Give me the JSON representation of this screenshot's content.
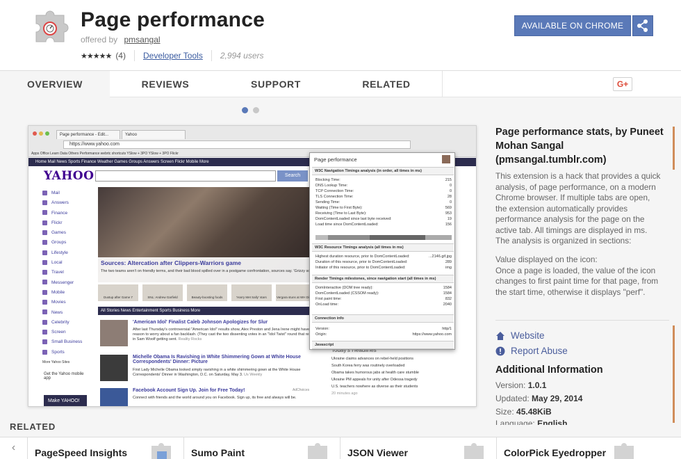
{
  "header": {
    "title": "Page performance",
    "offered_by_label": "offered by",
    "author": "pmsangal",
    "rating_stars": "★★★★★",
    "rating_count": "(4)",
    "category": "Developer Tools",
    "users": "2,994 users",
    "cta_label": "AVAILABLE ON CHROME"
  },
  "tabs": {
    "overview": "OVERVIEW",
    "reviews": "REVIEWS",
    "support": "SUPPORT",
    "related": "RELATED",
    "gplus": "G+"
  },
  "screenshot": {
    "tab1": "Page performance - Edit...",
    "tab2": "Yahoo",
    "url": "https://www.yahoo.com",
    "bookmarks": "Apps  Office  Learn  Data  Others  Performance  webrtc  shortcuts  YSlow + 3PO  YSlow + 3PO  Flickr",
    "nav": "Home  Mail  News  Sports  Finance  Weather  Games  Groups  Answers  Screen  Flickr  Mobile  More",
    "yahoo_logo": "YAHOO!",
    "search_btn": "Search",
    "menu": [
      "Mail",
      "Answers",
      "Finance",
      "Flickr",
      "Games",
      "Groups",
      "Lifestyle",
      "Local",
      "Travel",
      "Messenger",
      "Mobile",
      "Movies",
      "News",
      "Celebrity",
      "Screen",
      "Small Business",
      "Sports"
    ],
    "more_sites": "More Yahoo Sites",
    "hero_title": "Sources: Altercation after Clippers-Warriors game",
    "hero_sub": "The two teams aren't on friendly terms, and their bad blood spilled over in a postgame confrontation, sources say. 'Grizzy scene'",
    "thumbs": [
      "Dustup after Game 7",
      "SNL: Andrew Garfield",
      "Beauty-boosting foods",
      "'Harry Met Sally' stars",
      "Vergara stuns at WH Dinner"
    ],
    "stories_bar": "All Stories  News  Entertainment  Sports  Business    More",
    "stories": [
      {
        "title": "'American Idol' Finalist Caleb Johnson Apologizes for Slur",
        "body": "After last Thursday's controversial \"American Idol\" results show, Alex Preston and Jena Irene might have had reason to worry about a fan backlash. (They cast the two dissenting votes in an \"Idol Twist\" round that resulted in Sam Woolf getting sent.",
        "src": "Reality Rocks"
      },
      {
        "title": "Michelle Obama Is Ravishing in White Shimmering Gown at White House Correspondents' Dinner: Picture",
        "body": "First Lady Michelle Obama looked simply ravishing in a white shimmering gown at the White House Correspondents' Dinner in Washington, D.C. on Saturday, May 3.",
        "src": "Us Weekly"
      },
      {
        "title": "Facebook Account Sign Up. Join for Free Today!",
        "body": "Connect with friends and the world around you on Facebook. Sign up, its free and always will be.",
        "src": "AdChoices"
      }
    ],
    "get_yahoo": "Get the Yahoo mobile app",
    "make_yahoo": "Make YAHOO!",
    "headlines_title": "Today's Headlines",
    "headlines": [
      "Ukraine claims advances on rebel-held positions",
      "South Korea ferry was routinely overloaded",
      "Obama takes humorous jabs at health care stumble",
      "Ukraine PM appeals for unity after Odessa tragedy",
      "U.S. teachers nowhere as diverse as their students",
      "20 minutes ago"
    ],
    "popup": {
      "title": "Page performance",
      "sec1": "W3C Navigation Timings analysis (in order, all times in ms)",
      "rows1": [
        [
          "Blocking Time:",
          "215"
        ],
        [
          "DNS Lookup Time:",
          "0"
        ],
        [
          "TCP Connection Time:",
          "0"
        ],
        [
          "TLS Connection Time:",
          "28"
        ],
        [
          "Sending Time:",
          "0"
        ],
        [
          "Waiting (Time to First Byte):",
          "569"
        ],
        [
          "Receiving (Time to Last Byte):",
          "953"
        ],
        [
          "DomContentLoaded since last byte received:",
          "19"
        ],
        [
          "Load time since DomContentLoaded:",
          "156"
        ]
      ],
      "sec2": "W3C Resource Timings analysis (all times in ms)",
      "rows2": [
        [
          "Highest duration resource, prior to DomContentLoaded:",
          "...2146.gif.jpg"
        ],
        [
          "Duration of this resource, prior to DomContentLoaded:",
          "289"
        ],
        [
          "Initiator of this resource, prior to DomContentLoaded:",
          "img"
        ]
      ],
      "sec3": "Render Timings milestones, since navigation start (all times in ms)",
      "rows3": [
        [
          "DomInteractive (DOM tree ready):",
          "1584"
        ],
        [
          "DomContentLoaded (CSSOM ready):",
          "1584"
        ],
        [
          "First paint time:",
          "832"
        ],
        [
          "OnLoad time:",
          "2040"
        ]
      ],
      "sec4": "Connection info",
      "rows4": [
        [
          "Version:",
          "http/1"
        ],
        [
          "Origin:",
          "https://www.yahoo.com"
        ]
      ],
      "sec5": "Javascript"
    }
  },
  "description": {
    "title": "Page performance stats, by Puneet Mohan Sangal (pmsangal.tumblr.com)",
    "p1": "This extension is a hack that provides a quick analysis, of page performance, on a modern Chrome browser. If multiple tabs are open, the extension automatically provides performance analysis for the page on the active tab. All timings are displayed in ms. The analysis is organized in sections:",
    "p2": "Value displayed on the icon:\nOnce a page is loaded, the value of the icon changes to first paint time for that page, from the start time, otherwise it displays \"perf\"."
  },
  "sidebar": {
    "website": "Website",
    "report": "Report Abuse",
    "additional_title": "Additional Information",
    "version_label": "Version:",
    "version": "1.0.1",
    "updated_label": "Updated:",
    "updated": "May 29, 2014",
    "size_label": "Size:",
    "size": "45.48KiB",
    "language_label": "Language:",
    "language": "English"
  },
  "related": {
    "label": "RELATED",
    "arrow": "‹",
    "items": [
      "PageSpeed Insights",
      "Sumo Paint",
      "JSON Viewer",
      "ColorPick Eyedropper"
    ]
  },
  "colors": {
    "accent": "#5a79b8",
    "link": "#4a5d9c",
    "dot_active": "#5a79b8",
    "dot_inactive": "#c8c8c8"
  }
}
